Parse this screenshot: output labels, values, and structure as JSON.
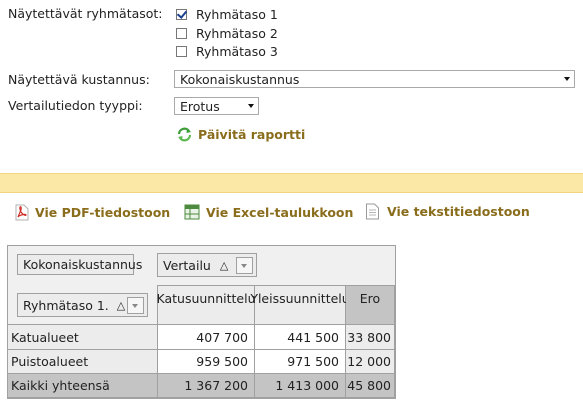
{
  "form": {
    "group_levels_label": "Näytettävät ryhmätasot:",
    "group_levels": [
      {
        "label": "Ryhmätaso 1",
        "checked": true
      },
      {
        "label": "Ryhmätaso 2",
        "checked": false
      },
      {
        "label": "Ryhmätaso 3",
        "checked": false
      }
    ],
    "cost_label": "Näytettävä kustannus:",
    "cost_value": "Kokonaiskustannus",
    "compare_label": "Vertailutiedon tyyppi:",
    "compare_value": "Erotus",
    "refresh_label": "Päivitä raportti"
  },
  "exports": {
    "pdf": "Vie PDF-tiedostoon",
    "excel": "Vie Excel-taulukkoon",
    "text": "Vie tekstitiedostoon"
  },
  "pivot": {
    "data_field": "Kokonaiskustannus",
    "column_field": "Vertailu",
    "row_field": "Ryhmätaso 1.",
    "sort_glyph": "△",
    "columns": [
      "Katusuunnittelu",
      "Yleissuunnittelu",
      "Ero"
    ],
    "rows": [
      {
        "label": "Katualueet",
        "values": [
          "407 700",
          "441 500",
          "33 800"
        ]
      },
      {
        "label": "Puistoalueet",
        "values": [
          "959 500",
          "971 500",
          "12 000"
        ]
      }
    ],
    "total": {
      "label": "Kaikki yhteensä",
      "values": [
        "1 367 200",
        "1 413 000",
        "45 800"
      ]
    }
  },
  "colors": {
    "accent_link": "#8a6d1c",
    "band": "#fbe7a6",
    "refresh_icon": "#3f9e3a"
  }
}
